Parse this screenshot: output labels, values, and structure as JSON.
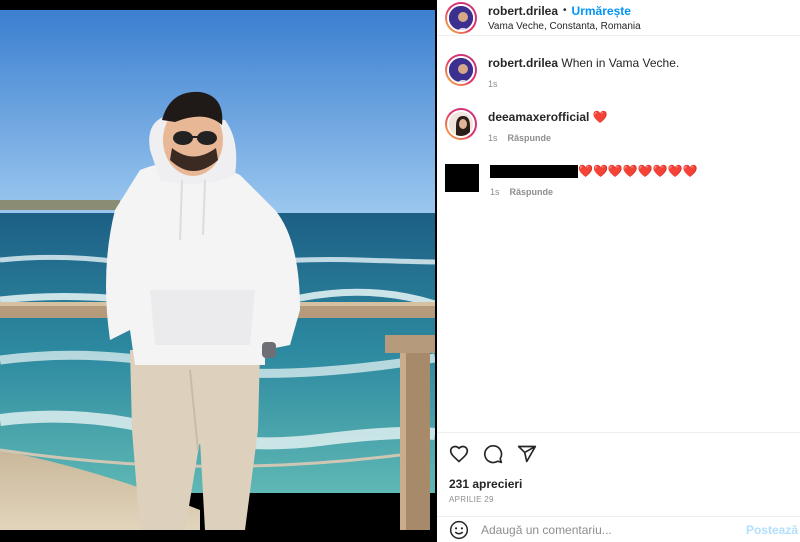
{
  "post": {
    "author": "robert.drilea",
    "separator": "•",
    "follow_label": "Urmărește",
    "location": "Vama Veche, Constanta, Romania"
  },
  "comments": [
    {
      "username": "robert.drilea",
      "text": "When in Vama Veche.",
      "time": "1s",
      "reply_label": ""
    },
    {
      "username": "deeamaxerofficial",
      "text": "❤️",
      "time": "1s",
      "reply_label": "Răspunde"
    },
    {
      "username": "",
      "text": "❤️❤️❤️❤️❤️❤️❤️❤️",
      "time": "1s",
      "reply_label": "Răspunde"
    }
  ],
  "actions": {
    "likes": "231 aprecieri",
    "date": "APRILIE 29",
    "like_icon": "heart-outline",
    "comment_icon": "speech-bubble",
    "share_icon": "paper-plane"
  },
  "add_comment": {
    "placeholder": "Adaugă un comentariu...",
    "post_label": "Postează"
  },
  "colors": {
    "accent": "#0095f6",
    "heart": "#ed4956",
    "muted": "#8e8e8e"
  }
}
